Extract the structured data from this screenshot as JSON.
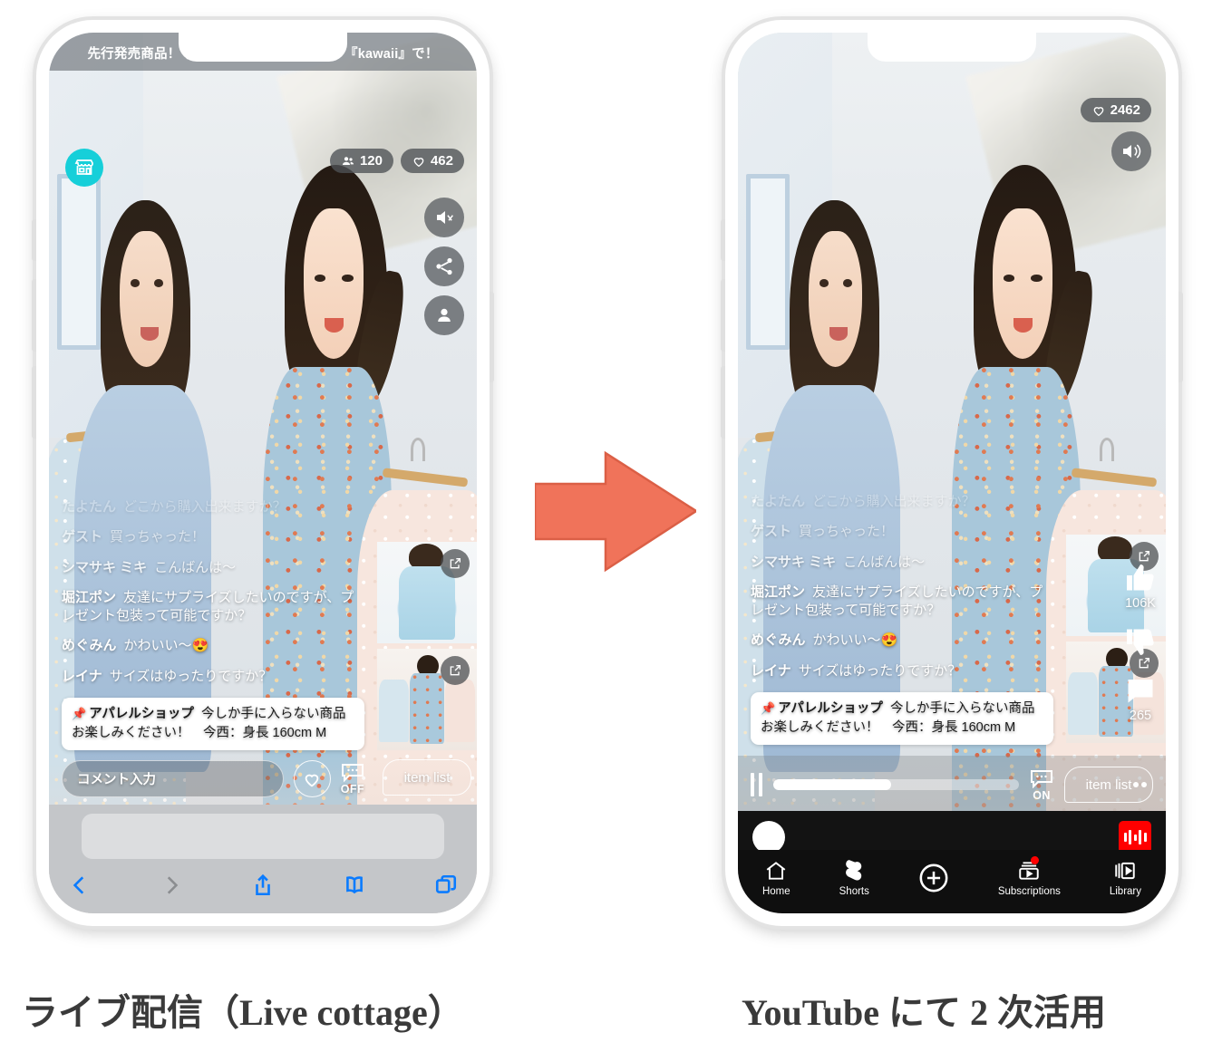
{
  "left_phone": {
    "banner_text": "先行発売商品！今だけ！闇市パスワードは 『kawaii』で！",
    "store_icon": "storefront-icon",
    "viewers_badge": {
      "icon": "people-icon",
      "value": "120"
    },
    "likes_badge": {
      "icon": "heart-icon",
      "value": "462"
    },
    "side_actions": [
      {
        "name": "mute-icon",
        "label": "mute"
      },
      {
        "name": "share-icon",
        "label": "share"
      },
      {
        "name": "person-icon",
        "label": "profile"
      }
    ],
    "comments": [
      {
        "who": "たよたん",
        "text": "どこから購入出来ますか？",
        "fade": "f1"
      },
      {
        "who": "ゲスト",
        "text": "買っちゃった！",
        "fade": "f2"
      },
      {
        "who": "シマサキ ミキ",
        "text": "こんばんは〜",
        "fade": "f3"
      },
      {
        "who": "堀江ポン",
        "text": "友達にサプライズしたいのですが、プレゼント包装って可能ですか？",
        "fade": ""
      },
      {
        "who": "めぐみん",
        "text": "かわいい〜😍",
        "fade": ""
      },
      {
        "who": "レイナ",
        "text": "サイズはゆったりですか？",
        "fade": ""
      }
    ],
    "pinned": {
      "shop": "アパレルショップ",
      "line1": "今しか手に入らない商品",
      "line2": "お楽しみください！　今西：身長 160cm M"
    },
    "comment_input_placeholder": "コメント入力",
    "heart_button": "heart-outline-icon",
    "comment_toggle": {
      "icon": "comment-bubble-icon",
      "state": "OFF"
    },
    "item_list_label": "item list",
    "safari": {
      "back": "chevron-left-icon",
      "forward": "chevron-right-icon",
      "share": "share-up-icon",
      "bookmarks": "book-icon",
      "tabs": "tabs-icon"
    }
  },
  "right_phone": {
    "likes_badge": {
      "icon": "heart-icon",
      "value": "2462"
    },
    "sound_button": "speaker-on-icon",
    "comments": [
      {
        "who": "たよたん",
        "text": "どこから購入出来ますか？",
        "fade": "f1"
      },
      {
        "who": "ゲスト",
        "text": "買っちゃった！",
        "fade": "f2"
      },
      {
        "who": "シマサキ ミキ",
        "text": "こんばんは〜",
        "fade": "f3"
      },
      {
        "who": "堀江ポン",
        "text": "友達にサプライズしたいのですが、プレゼント包装って可能ですか？",
        "fade": ""
      },
      {
        "who": "めぐみん",
        "text": "かわいい〜😍",
        "fade": ""
      },
      {
        "who": "レイナ",
        "text": "サイズはゆったりですか？",
        "fade": ""
      }
    ],
    "pinned": {
      "shop": "アパレルショップ",
      "line1": "今しか手に入らない商品",
      "line2": "お楽しみください！　今西：身長 160cm M"
    },
    "yt_actions": {
      "like": {
        "icon": "thumbs-up-icon",
        "count": "106K"
      },
      "dislike": {
        "icon": "thumbs-down-icon",
        "count": ""
      },
      "comments": {
        "icon": "comment-icon",
        "count": "265"
      }
    },
    "player": {
      "pause": "pause-icon",
      "progress_percent": 48,
      "comment_toggle": {
        "icon": "comment-bubble-icon",
        "state": "ON"
      },
      "item_list_label": "item list",
      "overflow": "more-dots-icon"
    },
    "bottom_nav": [
      {
        "name": "home",
        "label": "Home",
        "icon": "home-icon",
        "badge": false
      },
      {
        "name": "shorts",
        "label": "Shorts",
        "icon": "shorts-icon",
        "badge": false
      },
      {
        "name": "create",
        "label": "",
        "icon": "plus-circle-icon",
        "badge": false
      },
      {
        "name": "subscriptions",
        "label": "Subscriptions",
        "icon": "subscriptions-icon",
        "badge": true
      },
      {
        "name": "library",
        "label": "Library",
        "icon": "library-icon",
        "badge": false
      }
    ]
  },
  "arrow": {
    "color": "#F0735A"
  },
  "captions": {
    "left": "ライブ配信（Live cottage）",
    "right": "YouTube にて 2 次活用"
  }
}
